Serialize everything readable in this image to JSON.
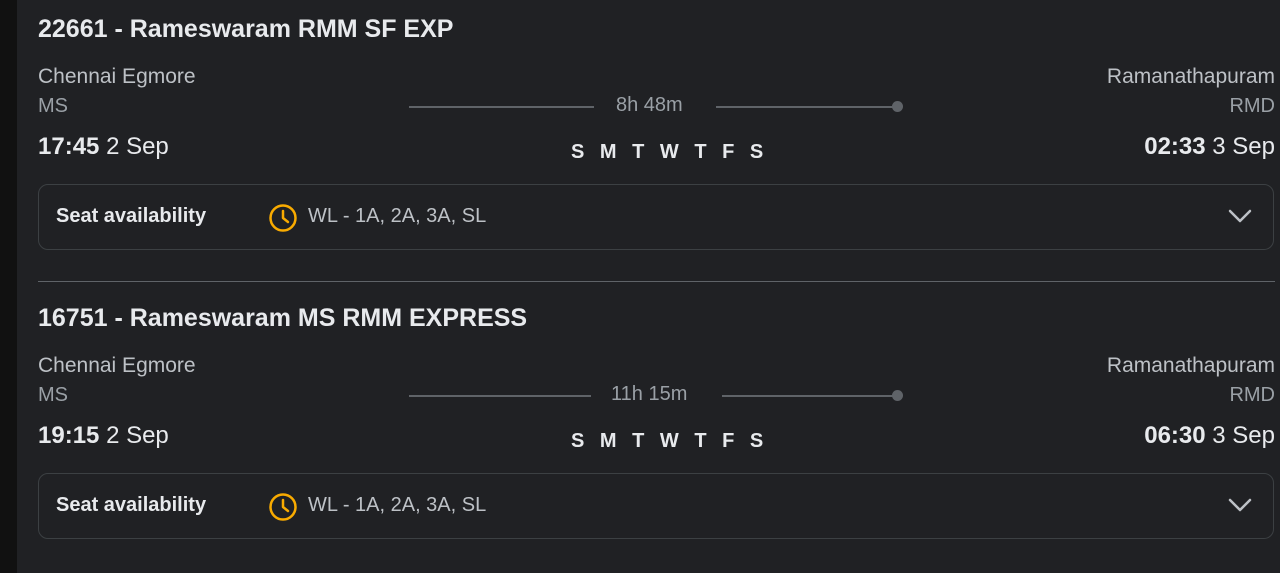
{
  "colors": {
    "accent_clock": "#f9ab00",
    "background": "#202124",
    "text": "#e8eaed"
  },
  "trains": [
    {
      "title": "22661 - Rameswaram RMM SF EXP",
      "from_station": "Chennai Egmore",
      "from_code": "MS",
      "to_station": "Ramanathapuram",
      "to_code": "RMD",
      "duration": "8h 48m",
      "days": "S M T W T F S",
      "dep_time": "17:45",
      "dep_date": "2 Sep",
      "arr_time": "02:33",
      "arr_date": "3 Sep",
      "seat_label": "Seat availability",
      "seat_status": "WL - 1A, 2A, 3A, SL",
      "status_icon": "clock-icon",
      "expand_icon": "chevron-down-icon"
    },
    {
      "title": "16751 - Rameswaram MS RMM EXPRESS",
      "from_station": "Chennai Egmore",
      "from_code": "MS",
      "to_station": "Ramanathapuram",
      "to_code": "RMD",
      "duration": "11h 15m",
      "days": "S M T W T F S",
      "dep_time": "19:15",
      "dep_date": "2 Sep",
      "arr_time": "06:30",
      "arr_date": "3 Sep",
      "seat_label": "Seat availability",
      "seat_status": "WL - 1A, 2A, 3A, SL",
      "status_icon": "clock-icon",
      "expand_icon": "chevron-down-icon"
    }
  ]
}
